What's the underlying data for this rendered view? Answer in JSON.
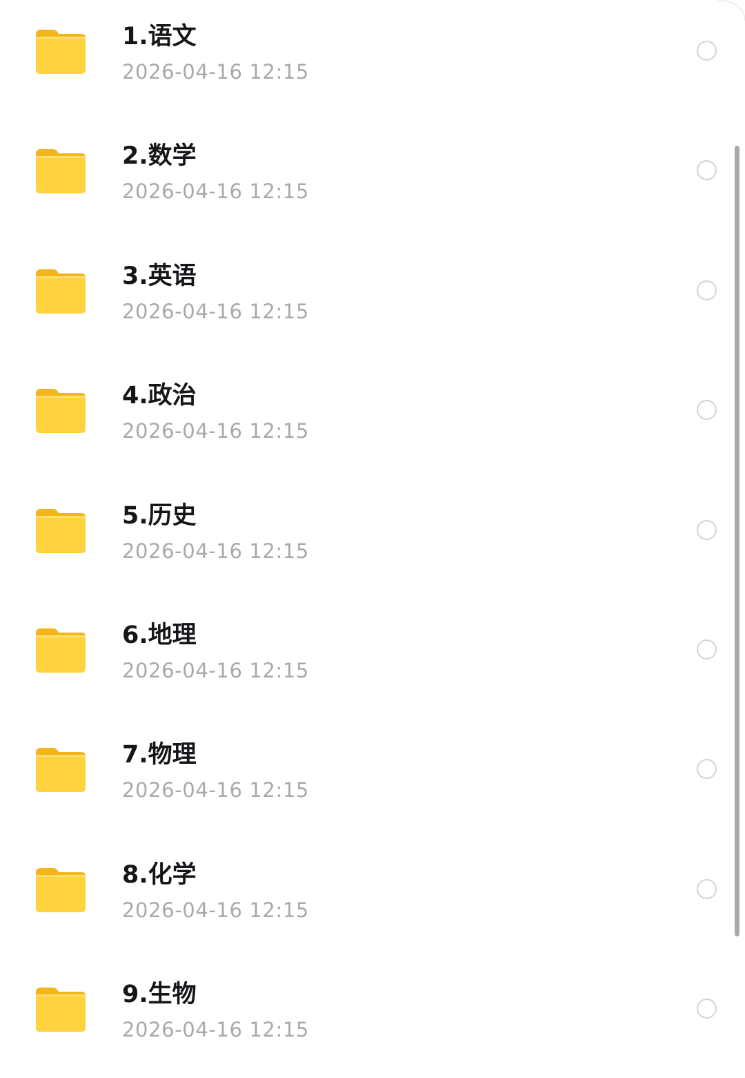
{
  "files": [
    {
      "name": "1.语文",
      "date": "2026-04-16 12:15",
      "icon": "folder-icon",
      "selected": false
    },
    {
      "name": "2.数学",
      "date": "2026-04-16 12:15",
      "icon": "folder-icon",
      "selected": false
    },
    {
      "name": "3.英语",
      "date": "2026-04-16 12:15",
      "icon": "folder-icon",
      "selected": false
    },
    {
      "name": "4.政治",
      "date": "2026-04-16 12:15",
      "icon": "folder-icon",
      "selected": false
    },
    {
      "name": "5.历史",
      "date": "2026-04-16 12:15",
      "icon": "folder-icon",
      "selected": false
    },
    {
      "name": "6.地理",
      "date": "2026-04-16 12:15",
      "icon": "folder-icon",
      "selected": false
    },
    {
      "name": "7.物理",
      "date": "2026-04-16 12:15",
      "icon": "folder-icon",
      "selected": false
    },
    {
      "name": "8.化学",
      "date": "2026-04-16 12:15",
      "icon": "folder-icon",
      "selected": false
    },
    {
      "name": "9.生物",
      "date": "2026-04-16 12:15",
      "icon": "folder-icon",
      "selected": false
    }
  ],
  "colors": {
    "folder_front": "#FFD23F",
    "folder_back": "#F2B51C",
    "name_text": "#15161A",
    "date_text": "#A7A9AE",
    "radio_border": "#D2D3D6",
    "scrollbar": "#A9A9AD"
  }
}
